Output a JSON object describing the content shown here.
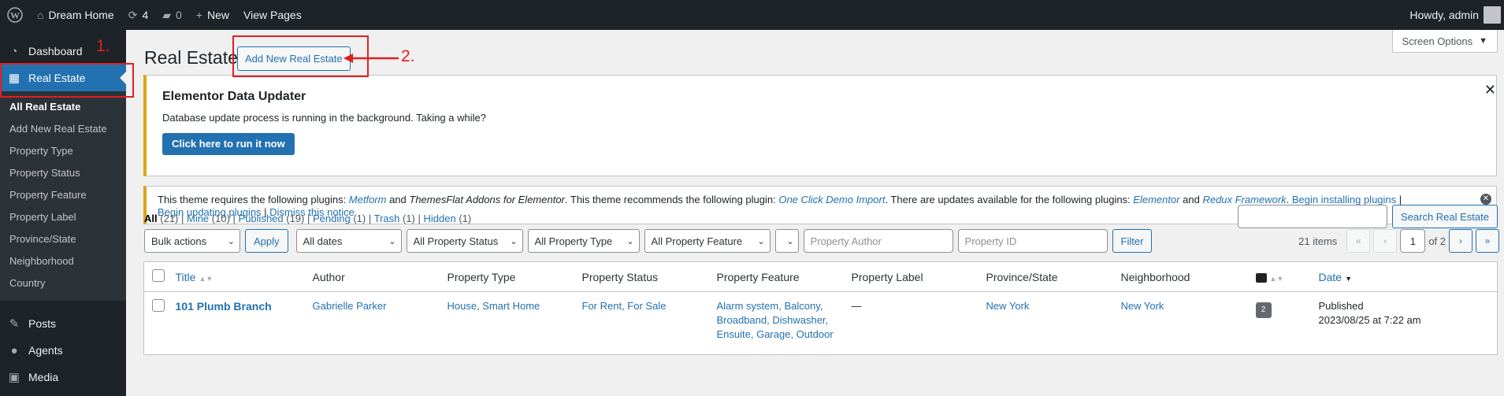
{
  "adminbar": {
    "site_name": "Dream Home",
    "updates_count": "4",
    "comments_count": "0",
    "new_label": "New",
    "view_pages_label": "View Pages",
    "howdy_label": "Howdy, admin"
  },
  "menu": {
    "dashboard": "Dashboard",
    "real_estate": "Real Estate",
    "submenu": [
      "All Real Estate",
      "Add New Real Estate",
      "Property Type",
      "Property Status",
      "Property Feature",
      "Property Label",
      "Province/State",
      "Neighborhood",
      "Country"
    ],
    "posts": "Posts",
    "agents": "Agents",
    "media": "Media"
  },
  "page": {
    "title": "Real Estate",
    "add_new_label": "Add New Real Estate",
    "screen_options": "Screen Options"
  },
  "elementor_notice": {
    "title": "Elementor Data Updater",
    "message": "Database update process is running in the background. Taking a while?",
    "button": "Click here to run it now"
  },
  "plugins_notice": {
    "t1": "This theme requires the following plugins: ",
    "p1": "Metform",
    "t2": " and ",
    "p2": "ThemesFlat Addons for Elementor",
    "t3": ". This theme recommends the following plugin: ",
    "p3": "One Click Demo Import",
    "t4": ". There are updates available for the following plugins: ",
    "p4": "Elementor",
    "t5": " and ",
    "p5": "Redux Framework",
    "t6": ". ",
    "begin_installing": "Begin installing plugins",
    "sep": " | ",
    "begin_updating": "Begin updating plugins",
    "dismiss": "Dismiss this notice"
  },
  "views": {
    "all": "All",
    "all_count": "(21)",
    "mine": "Mine",
    "mine_count": "(10)",
    "published": "Published",
    "published_count": "(19)",
    "pending": "Pending",
    "pending_count": "(1)",
    "trash": "Trash",
    "trash_count": "(1)",
    "hidden": "Hidden",
    "hidden_count": "(1)"
  },
  "search": {
    "button": "Search Real Estate",
    "value": ""
  },
  "filters": {
    "bulk_actions": "Bulk actions",
    "apply": "Apply",
    "all_dates": "All dates",
    "all_status": "All Property Status",
    "all_type": "All Property Type",
    "all_feature": "All Property Feature",
    "empty_select": "",
    "author_placeholder": "Property Author",
    "id_placeholder": "Property ID",
    "filter": "Filter"
  },
  "pagination": {
    "items": "21 items",
    "first": "«",
    "prev": "‹",
    "current": "1",
    "of": "of 2",
    "next": "›",
    "last": "»"
  },
  "table": {
    "headers": {
      "title": "Title",
      "author": "Author",
      "type": "Property Type",
      "status": "Property Status",
      "feature": "Property Feature",
      "label": "Property Label",
      "province": "Province/State",
      "neighborhood": "Neighborhood",
      "date": "Date"
    },
    "rows": [
      {
        "title": "101 Plumb Branch",
        "author": "Gabrielle Parker",
        "type": "House, Smart Home",
        "status": "For Rent, For Sale",
        "feature_1": "Alarm system, Balcony,",
        "feature_2": "Broadband, Dishwasher,",
        "feature_3": "Ensuite, Garage, Outdoor",
        "label": "—",
        "province": "New York",
        "neighborhood": "New York",
        "comments": "2",
        "date_status": "Published",
        "date": "2023/08/25 at 7:22 am"
      }
    ]
  },
  "annotations": {
    "step1": "1.",
    "step2": "2."
  },
  "colors": {
    "admin_bar": "#1d2327",
    "accent": "#2271b1",
    "annotation": "#e02020",
    "notice_warning": "#dba617"
  }
}
